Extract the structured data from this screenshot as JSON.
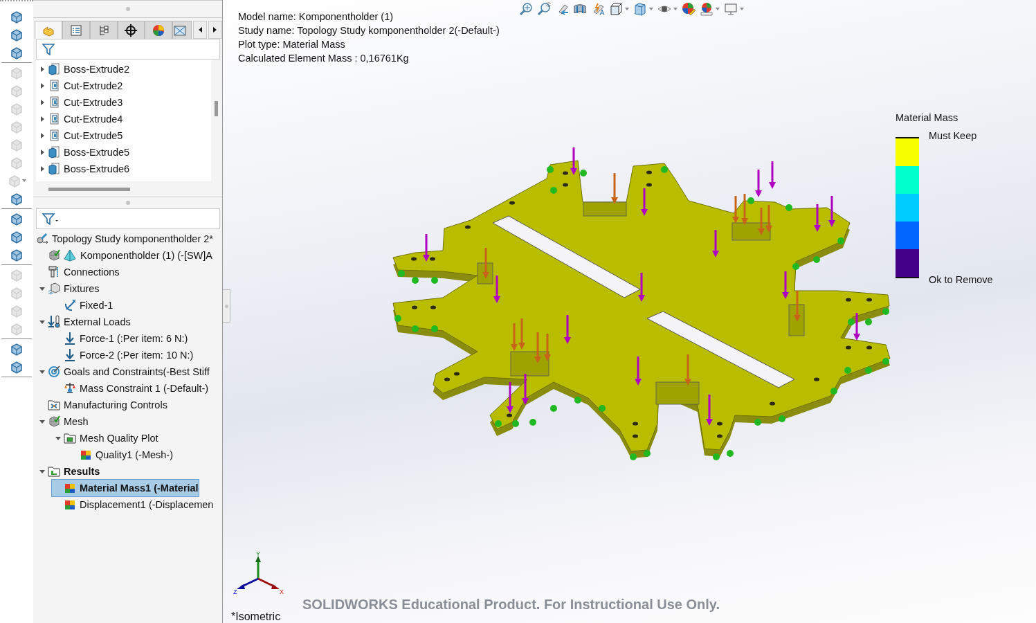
{
  "left_toolbar": {
    "groups": [
      [
        {
          "disabled": false,
          "dropdown": false
        },
        {
          "disabled": false,
          "dropdown": false
        },
        {
          "disabled": false,
          "dropdown": false
        }
      ],
      [
        {
          "disabled": true,
          "dropdown": false
        },
        {
          "disabled": true,
          "dropdown": false
        },
        {
          "disabled": true,
          "dropdown": false
        },
        {
          "disabled": true,
          "dropdown": false
        },
        {
          "disabled": true,
          "dropdown": false
        },
        {
          "disabled": true,
          "dropdown": false
        },
        {
          "disabled": true,
          "dropdown": true
        },
        {
          "disabled": false,
          "dropdown": false
        }
      ],
      [
        {
          "disabled": false,
          "dropdown": false
        },
        {
          "disabled": false,
          "dropdown": false
        },
        {
          "disabled": false,
          "dropdown": false
        }
      ],
      [
        {
          "disabled": true,
          "dropdown": false
        },
        {
          "disabled": true,
          "dropdown": false
        },
        {
          "disabled": true,
          "dropdown": false
        },
        {
          "disabled": true,
          "dropdown": false
        }
      ],
      [
        {
          "disabled": false,
          "dropdown": false
        },
        {
          "disabled": false,
          "dropdown": false
        }
      ]
    ]
  },
  "feature_panel": {
    "tabs": [
      {
        "kind": "features",
        "selected": true
      },
      {
        "kind": "properties",
        "selected": false
      },
      {
        "kind": "configurations",
        "selected": false
      },
      {
        "kind": "target",
        "selected": false
      },
      {
        "kind": "appearance",
        "selected": false
      },
      {
        "kind": "view",
        "selected": false
      }
    ],
    "items": [
      {
        "kind": "boss",
        "label": "Boss-Extrude2",
        "expandable": true,
        "expanded": false,
        "selected": false
      },
      {
        "kind": "cut",
        "label": "Cut-Extrude2",
        "expandable": true,
        "expanded": false,
        "selected": false
      },
      {
        "kind": "cut",
        "label": "Cut-Extrude3",
        "expandable": true,
        "expanded": false,
        "selected": false
      },
      {
        "kind": "cut",
        "label": "Cut-Extrude4",
        "expandable": true,
        "expanded": false,
        "selected": false
      },
      {
        "kind": "cut",
        "label": "Cut-Extrude5",
        "expandable": true,
        "expanded": false,
        "selected": false
      },
      {
        "kind": "boss",
        "label": "Boss-Extrude5",
        "expandable": true,
        "expanded": false,
        "selected": false
      },
      {
        "kind": "boss",
        "label": "Boss-Extrude6",
        "expandable": true,
        "expanded": false,
        "selected": false
      }
    ]
  },
  "study_tree": {
    "items": [
      {
        "kind": "study",
        "label": "Topology Study komponentholder 2*",
        "selected": false,
        "bold": false,
        "children": [
          {
            "kind": "part",
            "label": "Komponentholder (1) (-[SW]A",
            "selected": false,
            "bold": false
          },
          {
            "kind": "connections",
            "label": "Connections",
            "selected": false,
            "bold": false
          },
          {
            "kind": "fixtures",
            "label": "Fixtures",
            "expandable": true,
            "expanded": true,
            "selected": false,
            "bold": false,
            "children": [
              {
                "kind": "fixture",
                "label": "Fixed-1",
                "selected": false,
                "bold": false
              }
            ]
          },
          {
            "kind": "loads",
            "label": "External Loads",
            "expandable": true,
            "expanded": true,
            "selected": false,
            "bold": false,
            "children": [
              {
                "kind": "force",
                "label": "Force-1 (:Per item: 6 N:)",
                "selected": false,
                "bold": false
              },
              {
                "kind": "force",
                "label": "Force-2 (:Per item: 10 N:)",
                "selected": false,
                "bold": false
              }
            ]
          },
          {
            "kind": "goals",
            "label": "Goals and Constraints(-Best Stiff",
            "expandable": true,
            "expanded": true,
            "selected": false,
            "bold": false,
            "children": [
              {
                "kind": "constraint",
                "label": "Mass Constraint 1 (-Default-)",
                "selected": false,
                "bold": false
              }
            ]
          },
          {
            "kind": "manufacturing",
            "label": "Manufacturing Controls",
            "selected": false,
            "bold": false
          },
          {
            "kind": "mesh",
            "label": "Mesh",
            "expandable": true,
            "expanded": true,
            "selected": false,
            "bold": false,
            "children": [
              {
                "kind": "folder",
                "label": "Mesh Quality Plot",
                "expandable": true,
                "expanded": true,
                "selected": false,
                "bold": false,
                "children": [
                  {
                    "kind": "plot",
                    "label": "Quality1 (-Mesh-)",
                    "selected": false,
                    "bold": false
                  }
                ]
              }
            ]
          },
          {
            "kind": "results",
            "label": "Results",
            "expandable": true,
            "expanded": true,
            "selected": false,
            "bold": true,
            "children": [
              {
                "kind": "plot",
                "label": "Material Mass1 (-Material",
                "selected": true,
                "bold": true
              },
              {
                "kind": "plot",
                "label": "Displacement1 (-Displacemen",
                "selected": false,
                "bold": false
              }
            ]
          }
        ]
      }
    ]
  },
  "viewport": {
    "info_lines": [
      "Model name: Komponentholder (1)",
      "Study name: Topology Study komponentholder 2(-Default-)",
      "Plot type: Material Mass",
      "Calculated Element Mass :  0,16761Kg"
    ],
    "legend": {
      "title": "Material Mass",
      "max_label": "Must Keep",
      "min_label": "Ok to Remove",
      "bands": [
        {
          "color": "#f5ff00"
        },
        {
          "color": "#00ffcc"
        },
        {
          "color": "#00ccff"
        },
        {
          "color": "#0066ff"
        },
        {
          "color": "#440088"
        }
      ]
    },
    "triad": {
      "y": "Y",
      "z": "Z",
      "x": "X"
    },
    "notice": "SOLIDWORKS Educational Product. For Instructional Use Only.",
    "view_name": "*Isometric"
  }
}
